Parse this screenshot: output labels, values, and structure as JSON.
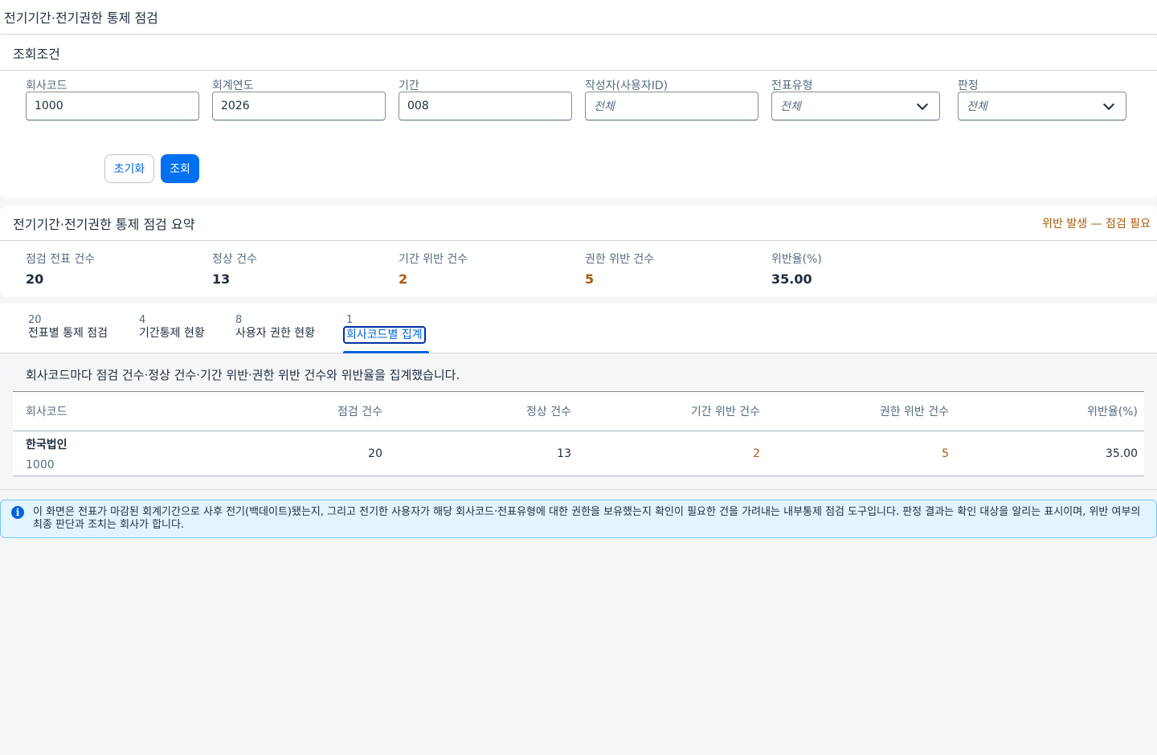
{
  "app": {
    "title": "전기기간·전기권한 통제 점검"
  },
  "filters": {
    "section_title": "조회조건",
    "fields": [
      {
        "label": "회사코드",
        "value": "1000",
        "placeholder": ""
      },
      {
        "label": "회계연도",
        "value": "2026",
        "placeholder": ""
      },
      {
        "label": "기간",
        "value": "008",
        "placeholder": ""
      },
      {
        "label": "작성자(사용자ID)",
        "value": "",
        "placeholder": "전체"
      },
      {
        "label": "전표유형",
        "value": "전체",
        "type": "select"
      },
      {
        "label": "판정",
        "value": "전체",
        "type": "select"
      }
    ],
    "reset_label": "초기화",
    "search_label": "조회"
  },
  "summary": {
    "title": "전기기간·전기권한 통제 점검 요약",
    "status": "위반 발생 — 점검 필요",
    "status_color": "#aa5808",
    "kpis": [
      {
        "label": "점검 전표 건수",
        "value": "20"
      },
      {
        "label": "정상 건수",
        "value": "13"
      },
      {
        "label": "기간 위반 건수",
        "value": "2",
        "warn": true
      },
      {
        "label": "권한 위반 건수",
        "value": "5",
        "warn": true
      },
      {
        "label": "위반율(%)",
        "value": "35.00"
      }
    ]
  },
  "tabs": [
    {
      "count": "20",
      "label": "전표별 통제 점검"
    },
    {
      "count": "4",
      "label": "기간통제 현황"
    },
    {
      "count": "8",
      "label": "사용자 권한 현황"
    },
    {
      "count": "1",
      "label": "회사코드별 집계",
      "active": true
    }
  ],
  "content": {
    "description": "회사코드마다 점검 건수·정상 건수·기간 위반·권한 위반 건수와 위반율을 집계했습니다.",
    "table": {
      "columns": [
        "회사코드",
        "점검 건수",
        "정상 건수",
        "기간 위반 건수",
        "권한 위반 건수",
        "위반율(%)"
      ],
      "rows": [
        {
          "name": "한국법인",
          "code": "1000",
          "checked": "20",
          "normal": "13",
          "period_violation": "2",
          "auth_violation": "5",
          "rate": "35.00"
        }
      ]
    }
  },
  "info": {
    "icon": "info-icon",
    "text": "이 화면은 전표가 마감된 회계기간으로 사후 전기(백데이트)됐는지, 그리고 전기한 사용자가 해당 회사코드·전표유형에 대한 권한을 보유했는지 확인이 필요한 건을 가려내는 내부통제 점검 도구입니다. 판정 결과는 확인 대상을 알리는 표시이며, 위반 여부의 최종 판단과 조치는 회사가 합니다."
  },
  "colors": {
    "accent": "#0070f2",
    "warning": "#aa5808",
    "info_bg": "#e1f4ff"
  }
}
